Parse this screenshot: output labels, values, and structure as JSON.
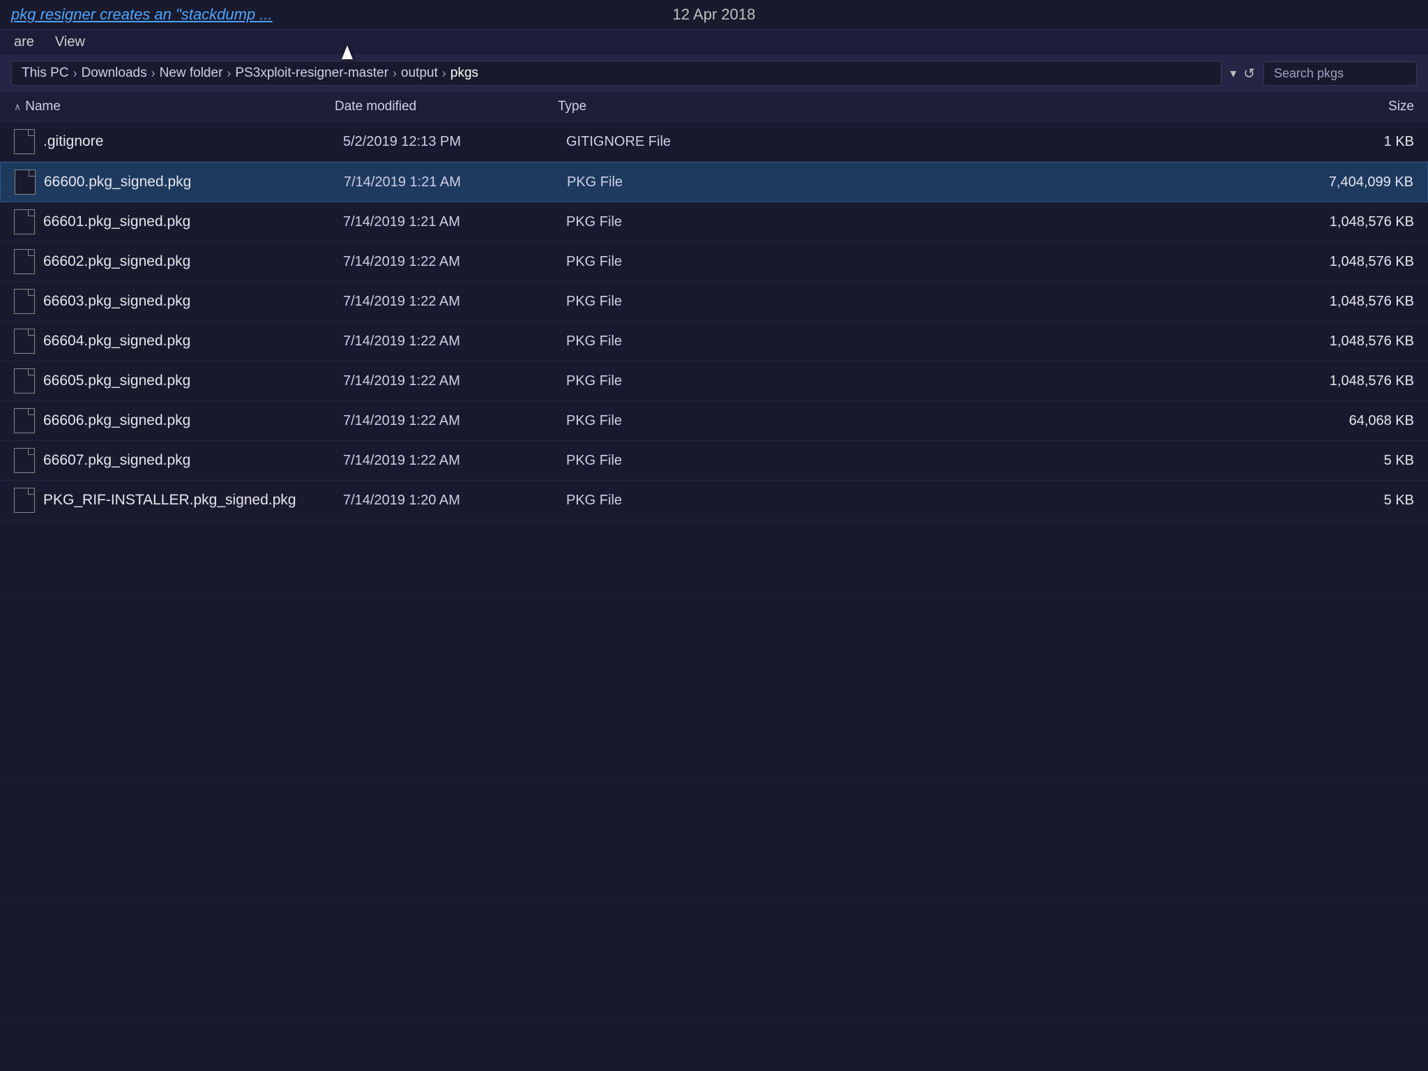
{
  "titlebar": {
    "left_text": "pkg resigner creates an \"stackdump ...",
    "date": "12 Apr 2018"
  },
  "menubar": {
    "items": [
      "are",
      "View"
    ]
  },
  "addressbar": {
    "breadcrumbs": [
      {
        "label": "This PC",
        "active": false
      },
      {
        "label": "Downloads",
        "active": false
      },
      {
        "label": "New folder",
        "active": false
      },
      {
        "label": "PS3xploit-resigner-master",
        "active": false
      },
      {
        "label": "output",
        "active": false
      },
      {
        "label": "pkgs",
        "active": true
      }
    ],
    "search_placeholder": "Search pkgs",
    "dropdown_icon": "▾",
    "refresh_icon": "↺"
  },
  "columns": {
    "name": "Name",
    "date_modified": "Date modified",
    "type": "Type",
    "size": "Size",
    "sort_indicator": "∧"
  },
  "files": [
    {
      "name": ".gitignore",
      "date": "5/2/2019 12:13 PM",
      "type": "GITIGNORE File",
      "size": "1 KB",
      "selected": false
    },
    {
      "name": "66600.pkg_signed.pkg",
      "date": "7/14/2019 1:21 AM",
      "type": "PKG File",
      "size": "7,404,099 KB",
      "selected": true
    },
    {
      "name": "66601.pkg_signed.pkg",
      "date": "7/14/2019 1:21 AM",
      "type": "PKG File",
      "size": "1,048,576 KB",
      "selected": false
    },
    {
      "name": "66602.pkg_signed.pkg",
      "date": "7/14/2019 1:22 AM",
      "type": "PKG File",
      "size": "1,048,576 KB",
      "selected": false
    },
    {
      "name": "66603.pkg_signed.pkg",
      "date": "7/14/2019 1:22 AM",
      "type": "PKG File",
      "size": "1,048,576 KB",
      "selected": false
    },
    {
      "name": "66604.pkg_signed.pkg",
      "date": "7/14/2019 1:22 AM",
      "type": "PKG File",
      "size": "1,048,576 KB",
      "selected": false
    },
    {
      "name": "66605.pkg_signed.pkg",
      "date": "7/14/2019 1:22 AM",
      "type": "PKG File",
      "size": "1,048,576 KB",
      "selected": false
    },
    {
      "name": "66606.pkg_signed.pkg",
      "date": "7/14/2019 1:22 AM",
      "type": "PKG File",
      "size": "64,068 KB",
      "selected": false
    },
    {
      "name": "66607.pkg_signed.pkg",
      "date": "7/14/2019 1:22 AM",
      "type": "PKG File",
      "size": "5 KB",
      "selected": false
    },
    {
      "name": "PKG_RIF-INSTALLER.pkg_signed.pkg",
      "date": "7/14/2019 1:20 AM",
      "type": "PKG File",
      "size": "5 KB",
      "selected": false
    }
  ]
}
